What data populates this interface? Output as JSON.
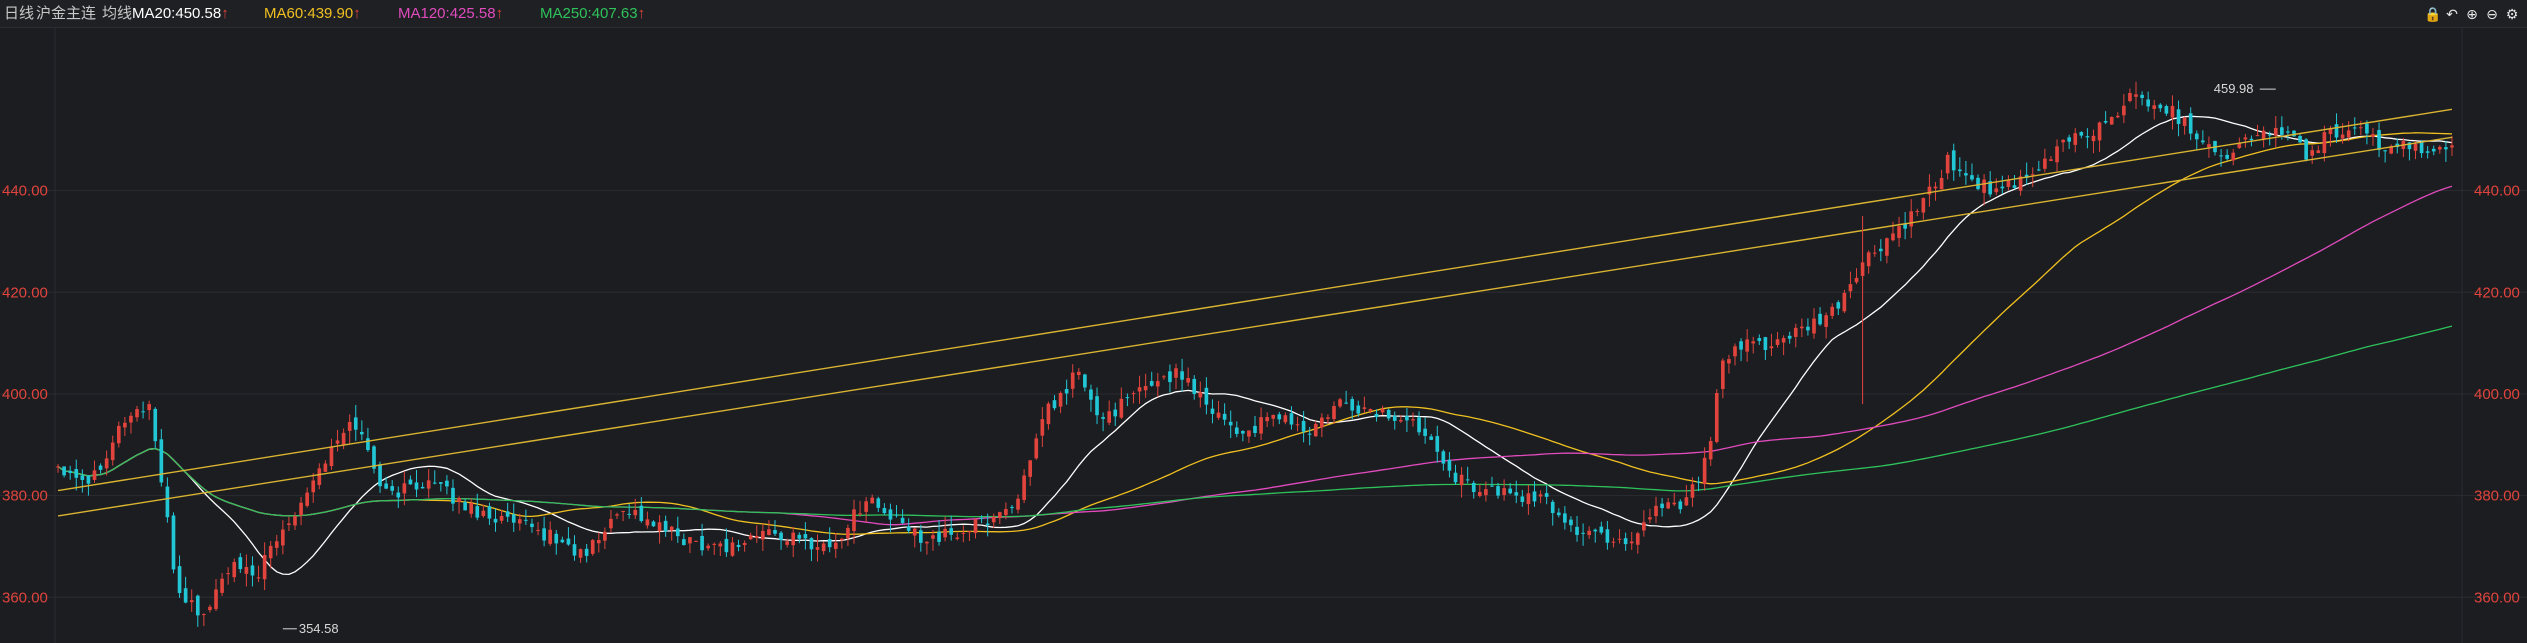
{
  "header": {
    "period": "日线",
    "symbol": "沪金主连",
    "ma_label": "均线",
    "ma_items": [
      {
        "label": "MA20:450.58",
        "arrow": "↑",
        "color": "#ffffff"
      },
      {
        "label": "MA60:439.90",
        "arrow": "↑",
        "color": "#f0c020"
      },
      {
        "label": "MA120:425.58",
        "arrow": "↑",
        "color": "#e04bbd"
      },
      {
        "label": "MA250:407.63",
        "arrow": "↑",
        "color": "#2fc25b"
      }
    ],
    "tools": [
      {
        "name": "lock-icon",
        "glyph": "🔒"
      },
      {
        "name": "undo-icon",
        "glyph": "↶"
      },
      {
        "name": "zoom-in-icon",
        "glyph": "⊕"
      },
      {
        "name": "zoom-out-icon",
        "glyph": "⊖"
      },
      {
        "name": "settings-icon",
        "glyph": "⚙"
      }
    ]
  },
  "colors": {
    "up": "#e0443c",
    "down": "#22c7d6",
    "grid": "#2a2c32",
    "axis_text": "#e0443c",
    "trendline": "#d9b431"
  },
  "chart_data": {
    "type": "candlestick",
    "ylim": [
      351,
      472
    ],
    "yticks": [
      "360.00",
      "380.00",
      "400.00",
      "420.00",
      "440.00"
    ],
    "n_bars": 395,
    "annotations": [
      {
        "label": "459.98",
        "value": 459.98,
        "index": 365
      },
      {
        "label": "354.58",
        "value": 354.58,
        "index": 37
      }
    ],
    "close_path": [
      [
        0,
        386
      ],
      [
        10,
        383
      ],
      [
        20,
        395
      ],
      [
        28,
        398
      ],
      [
        36,
        362
      ],
      [
        44,
        356
      ],
      [
        52,
        366
      ],
      [
        60,
        364
      ],
      [
        70,
        375
      ],
      [
        80,
        386
      ],
      [
        90,
        395
      ],
      [
        100,
        380
      ],
      [
        112,
        383
      ],
      [
        124,
        378
      ],
      [
        136,
        375
      ],
      [
        150,
        372
      ],
      [
        160,
        368
      ],
      [
        172,
        378
      ],
      [
        182,
        374
      ],
      [
        192,
        371
      ],
      [
        205,
        370
      ],
      [
        215,
        373
      ],
      [
        226,
        371
      ],
      [
        236,
        370
      ],
      [
        246,
        380
      ],
      [
        252,
        376
      ],
      [
        262,
        372
      ],
      [
        272,
        372
      ],
      [
        282,
        375
      ],
      [
        290,
        378
      ],
      [
        296,
        386
      ],
      [
        300,
        397
      ],
      [
        304,
        398
      ],
      [
        310,
        405
      ],
      [
        316,
        395
      ],
      [
        324,
        398
      ],
      [
        334,
        403
      ],
      [
        342,
        404
      ],
      [
        350,
        398
      ],
      [
        360,
        392
      ],
      [
        372,
        396
      ],
      [
        380,
        392
      ],
      [
        390,
        398
      ],
      [
        396,
        397
      ],
      [
        404,
        396
      ],
      [
        416,
        393
      ],
      [
        426,
        383
      ],
      [
        430,
        382
      ],
      [
        436,
        381
      ],
      [
        452,
        379
      ],
      [
        462,
        373
      ],
      [
        478,
        371
      ],
      [
        486,
        378
      ],
      [
        495,
        379
      ],
      [
        502,
        388
      ],
      [
        506,
        406
      ],
      [
        514,
        410
      ],
      [
        522,
        410
      ],
      [
        530,
        412
      ],
      [
        540,
        416
      ],
      [
        548,
        425
      ],
      [
        556,
        430
      ],
      [
        566,
        436
      ],
      [
        575,
        446
      ],
      [
        582,
        442
      ],
      [
        590,
        440
      ],
      [
        600,
        442
      ],
      [
        610,
        450
      ],
      [
        620,
        452
      ],
      [
        630,
        458
      ],
      [
        636,
        458
      ],
      [
        644,
        455
      ],
      [
        652,
        450
      ],
      [
        660,
        447
      ],
      [
        668,
        451
      ],
      [
        676,
        452
      ],
      [
        684,
        447
      ],
      [
        690,
        451
      ],
      [
        698,
        452
      ],
      [
        706,
        449
      ],
      [
        712,
        449
      ],
      [
        720,
        447
      ],
      [
        728,
        450
      ]
    ],
    "moving_averages": [
      {
        "name": "MA20",
        "value": 450.58,
        "color": "#ffffff"
      },
      {
        "name": "MA60",
        "value": 439.9,
        "color": "#f0c020"
      },
      {
        "name": "MA120",
        "value": 425.58,
        "color": "#e04bbd"
      },
      {
        "name": "MA250",
        "value": 407.63,
        "color": "#2fc25b"
      }
    ],
    "trendlines": [
      {
        "from": [
          0,
          381
        ],
        "to": [
          394,
          456
        ]
      },
      {
        "from": [
          0,
          376
        ],
        "to": [
          394,
          450.5
        ]
      }
    ]
  }
}
